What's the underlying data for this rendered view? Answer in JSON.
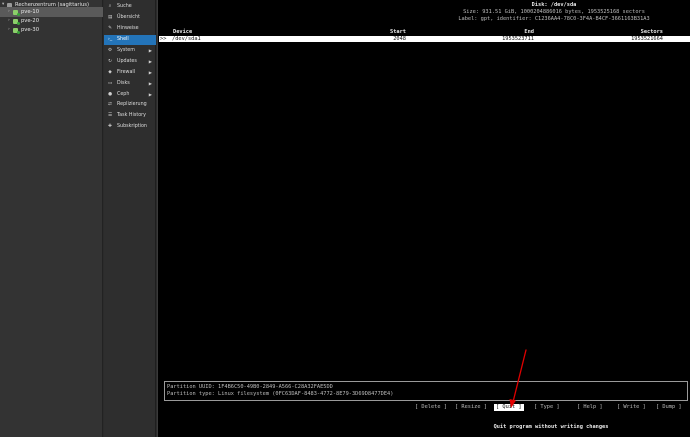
{
  "tree": {
    "datacenter": "Rechenzentrum (sagittarius)",
    "nodes": [
      {
        "label": "pve-10",
        "selected": true
      },
      {
        "label": "pve-20",
        "selected": false
      },
      {
        "label": "pve-30",
        "selected": false
      }
    ]
  },
  "menu": {
    "items": [
      {
        "label": "Suche",
        "icon": "search-icon"
      },
      {
        "label": "Übersicht",
        "icon": "summary-icon"
      },
      {
        "label": "Hinweise",
        "icon": "notes-icon"
      },
      {
        "label": "Shell",
        "icon": "shell-icon",
        "active": true
      },
      {
        "label": "System",
        "icon": "gear-icon",
        "submenu": true
      },
      {
        "label": "Updates",
        "icon": "refresh-icon",
        "submenu": true
      },
      {
        "label": "Firewall",
        "icon": "shield-icon",
        "submenu": true
      },
      {
        "label": "Disks",
        "icon": "disk-icon",
        "submenu": true
      },
      {
        "label": "Ceph",
        "icon": "ceph-icon",
        "submenu": true
      },
      {
        "label": "Replizierung",
        "icon": "retweet-icon"
      },
      {
        "label": "Task History",
        "icon": "list-icon"
      },
      {
        "label": "Subskription",
        "icon": "support-icon"
      }
    ]
  },
  "terminal": {
    "disk_title": "Disk: /dev/sda",
    "size_line": "Size: 931.51 GiB, 1000204886016 bytes, 1953525168 sectors",
    "label_line": "Label: gpt, identifier: C1236AA4-78C0-3F4A-B4CF-3661163B31A3",
    "columns": {
      "device": "Device",
      "start": "Start",
      "end": "End",
      "sectors": "Sectors"
    },
    "row": {
      "marker": ">>",
      "device": "/dev/sda1",
      "start": "2048",
      "end": "1953523711",
      "sectors": "1953521664"
    },
    "partition_uuid": "Partition UUID: 1F4B6C50-49B0-2849-A566-C28A32FAE5DD",
    "partition_type": "Partition type: Linux filesystem (0FC63DAF-8483-4772-8E79-3D69D8477DE4)",
    "menu": [
      {
        "label": "[ Delete ]"
      },
      {
        "label": "[ Resize ]"
      },
      {
        "label": "[ Quit ]",
        "active": true
      },
      {
        "label": "[ Type ]"
      },
      {
        "label": "[ Help ]"
      },
      {
        "label": "[ Write ]"
      },
      {
        "label": "[ Dump ]"
      }
    ],
    "hint": "Quit program without writing changes"
  },
  "annotation": {
    "color": "#e00000"
  }
}
